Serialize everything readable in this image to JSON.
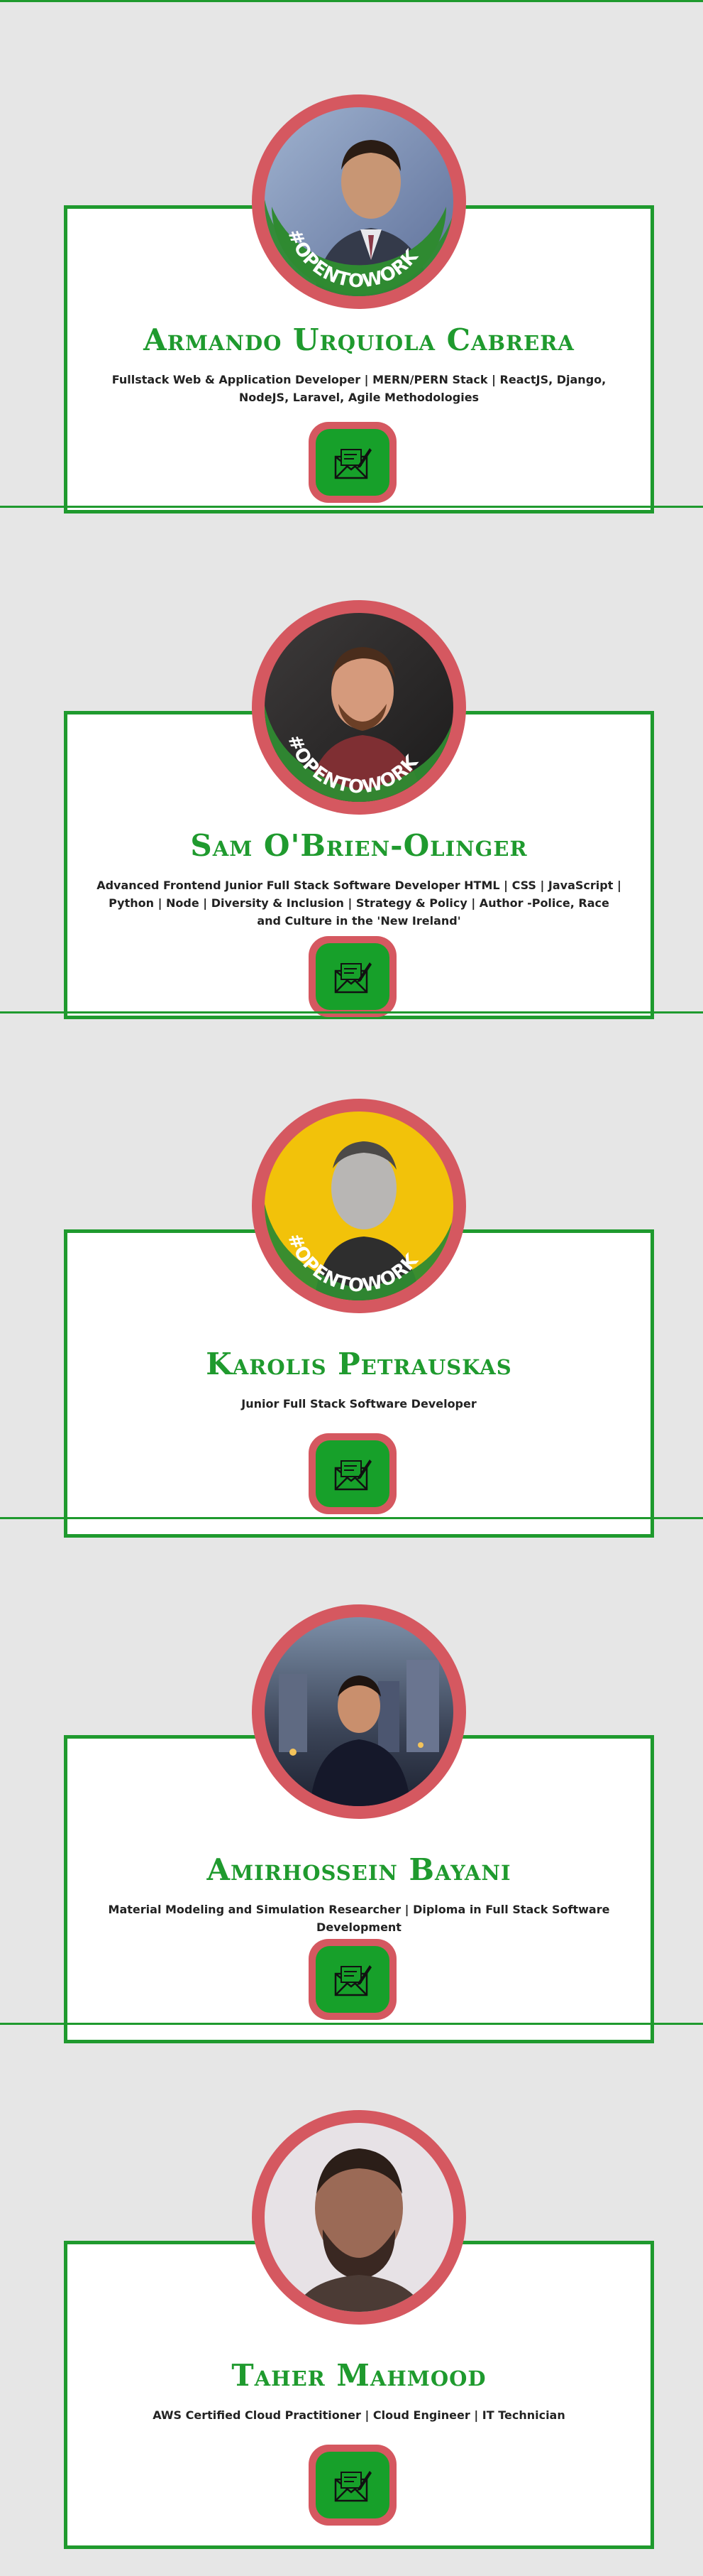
{
  "profiles": [
    {
      "name": "Armando Urquiola Cabrera",
      "headline": "Fullstack Web & Application Developer | MERN/PERN Stack | ReactJS, Django, NodeJS, Laravel, Agile Methodologies",
      "open_to_work": true,
      "badge_text": "#OPENTOWORK",
      "contact_icon": "envelope-letter-icon"
    },
    {
      "name": "Sam O'Brien-Olinger",
      "headline": "Advanced Frontend Junior Full Stack Software Developer HTML | CSS | JavaScript | Python | Node | Diversity & Inclusion | Strategy & Policy | Author -Police, Race and Culture in the 'New Ireland'",
      "open_to_work": true,
      "badge_text": "#OPENTOWORK",
      "contact_icon": "envelope-letter-icon"
    },
    {
      "name": "Karolis Petrauskas",
      "headline": "Junior Full Stack Software Developer",
      "open_to_work": true,
      "badge_text": "#OPENTOWORK",
      "contact_icon": "envelope-letter-icon"
    },
    {
      "name": "Amirhossein Bayani",
      "headline": "Material Modeling and Simulation Researcher | Diploma in Full Stack Software Development",
      "open_to_work": false,
      "badge_text": "",
      "contact_icon": "envelope-letter-icon"
    },
    {
      "name": "Taher Mahmood",
      "headline": "AWS Certified Cloud Practitioner | Cloud Engineer | IT Technician",
      "open_to_work": false,
      "badge_text": "",
      "contact_icon": "envelope-letter-icon"
    }
  ],
  "colors": {
    "accent_green": "#1f9a2e",
    "ring_red": "#d55860",
    "button_green": "#17a02a",
    "page_bg": "#e6e6e6"
  }
}
